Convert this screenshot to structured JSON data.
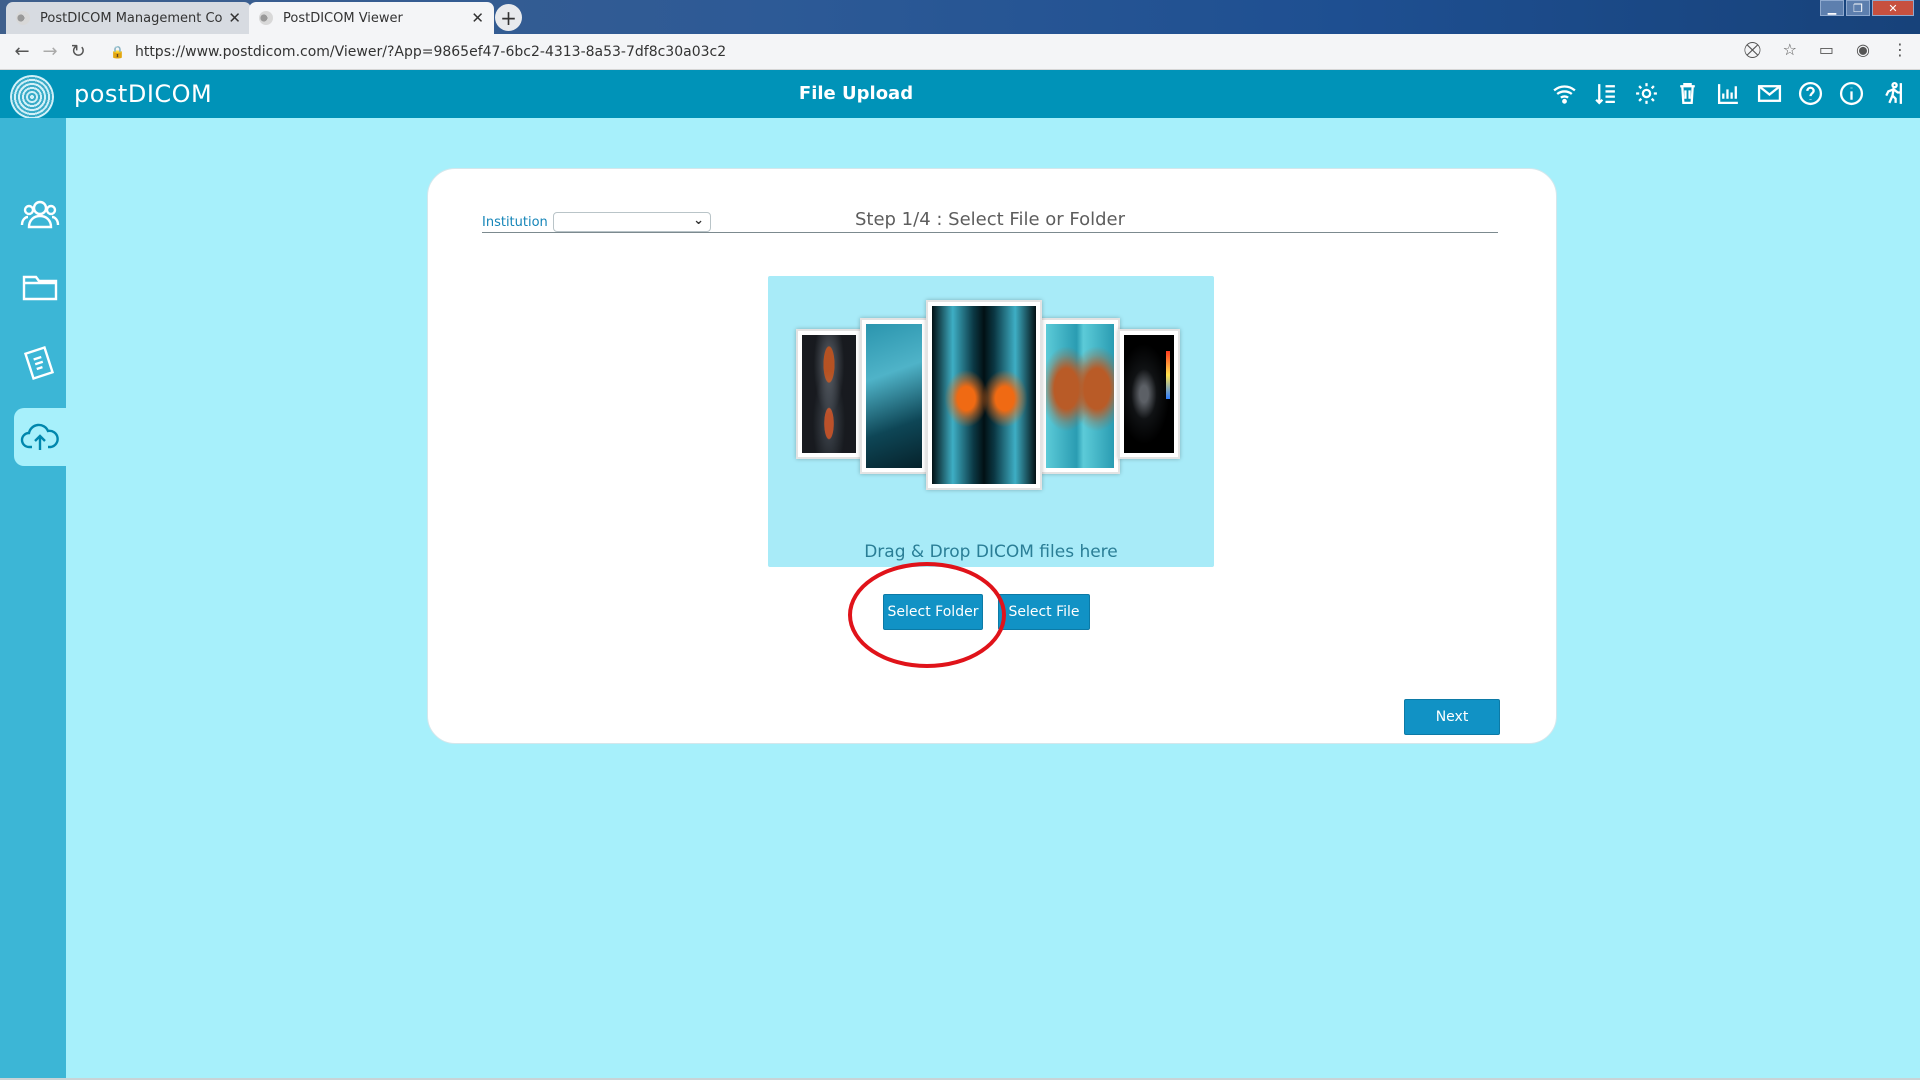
{
  "browser": {
    "tabs": [
      {
        "title": "PostDICOM Management Conso",
        "active": false
      },
      {
        "title": "PostDICOM Viewer",
        "active": true
      }
    ],
    "url": "https://www.postdicom.com/Viewer/?App=9865ef47-6bc2-4313-8a53-7df8c30a03c2"
  },
  "app": {
    "brand": "postDICOM",
    "page_title": "File Upload",
    "header_icons": [
      "wifi-icon",
      "sort-icon",
      "gear-icon",
      "trash-icon",
      "chart-icon",
      "mail-icon",
      "help-icon",
      "info-icon",
      "logout-icon"
    ],
    "sidebar_items": [
      "users-icon",
      "folder-icon",
      "documents-icon",
      "cloud-upload-icon"
    ],
    "active_sidebar_item": "cloud-upload-icon"
  },
  "upload": {
    "institution_label": "Institution",
    "institution_value": "",
    "step_title": "Step 1/4 : Select File or Folder",
    "drop_text": "Drag & Drop DICOM files here",
    "select_folder_label": "Select Folder",
    "select_file_label": "Select File",
    "next_label": "Next"
  },
  "colors": {
    "header": "#0093b8",
    "sidebar": "#3cb6d6",
    "background": "#a7f0fb",
    "button": "#1192c5",
    "highlight": "#e0131a"
  }
}
